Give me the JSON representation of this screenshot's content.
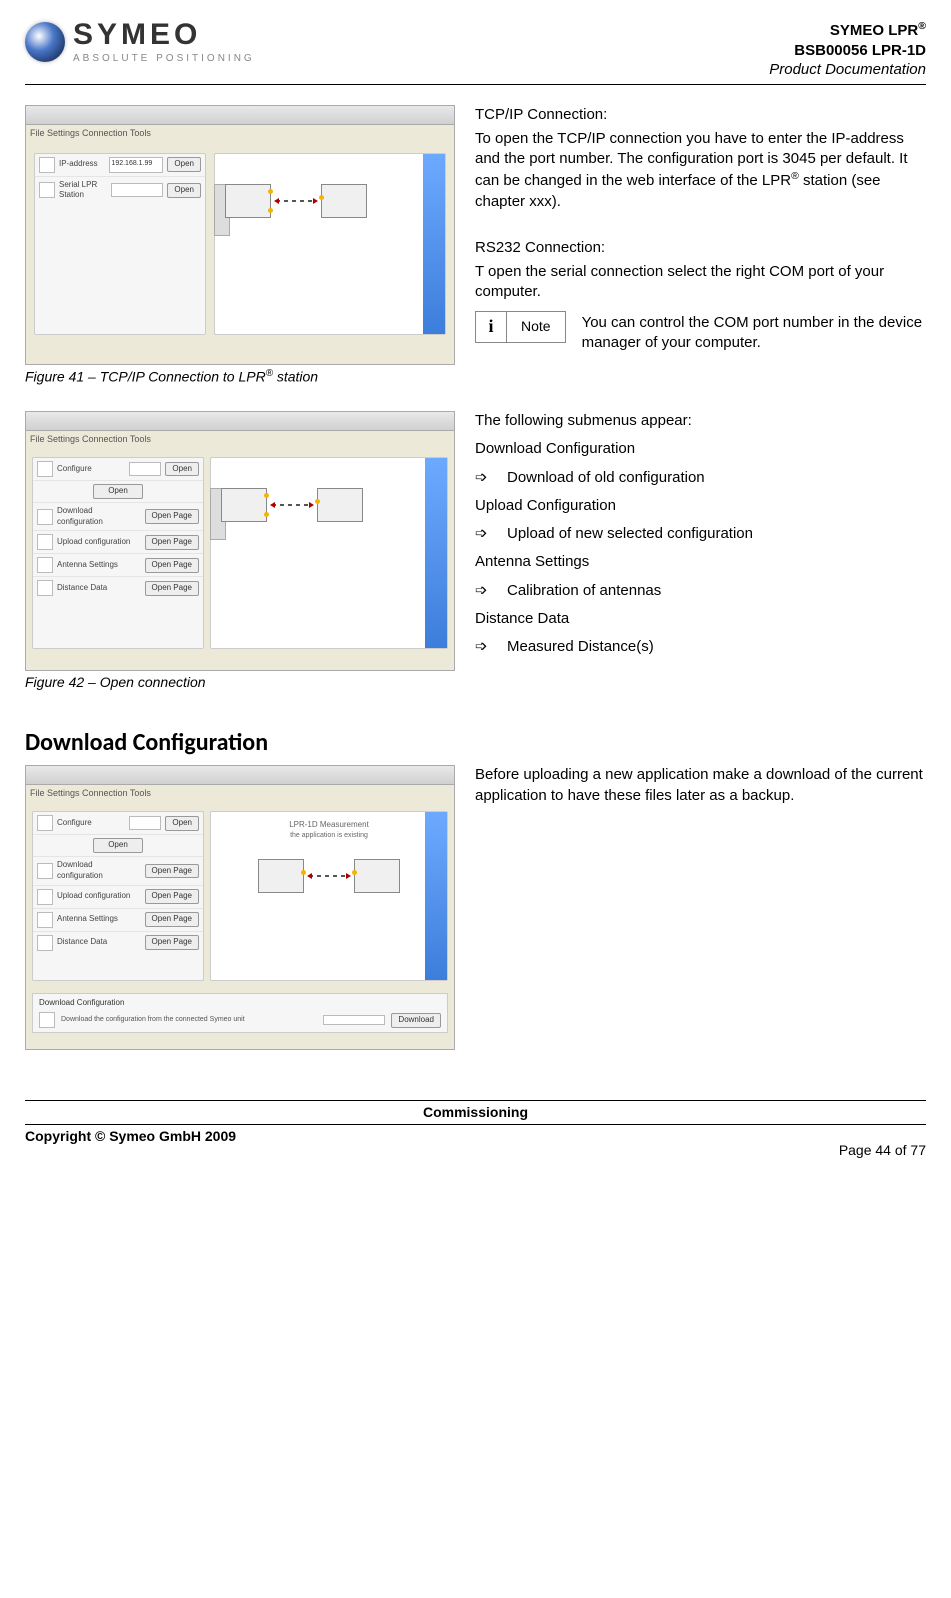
{
  "header": {
    "logo_name": "SYMEO",
    "logo_tag": "ABSOLUTE POSITIONING",
    "line1_pre": "SYMEO LPR",
    "line1_sup": "®",
    "line2": "BSB00056 LPR-1D",
    "line3": "Product Documentation"
  },
  "fig41": {
    "caption_pre": "Figure 41 – TCP/IP Connection to LPR",
    "caption_sup": "®",
    "caption_post": " station",
    "menu": "File   Settings   Connection   Tools",
    "row1_label": "IP-address",
    "row1_value": "192.168.1.99",
    "row1_btn": "Open",
    "row2_label": "Serial LPR Station",
    "row2_btn": "Open"
  },
  "tcp": {
    "title": "TCP/IP Connection:",
    "body_pre": "To open the TCP/IP connection you have to enter the IP-address and the port number. The configuration port is 3045 per default. It can be changed in the web interface of the LPR",
    "body_sup": "®",
    "body_post": " station (see chapter xxx)."
  },
  "rs232": {
    "title": "RS232 Connection:",
    "body": "T open the serial connection select the right COM port of your computer."
  },
  "note": {
    "label": "Note",
    "text": "You can control the COM port number in the device manager of your computer."
  },
  "fig42": {
    "caption": "Figure 42 – Open connection",
    "menu": "File   Settings   Connection   Tools",
    "row_conf": "Configure",
    "row_open": "Open",
    "list1": "Download configuration",
    "list2": "Upload configuration",
    "list3": "Antenna Settings",
    "list4": "Distance Data",
    "btn": "Open Page"
  },
  "submenu": {
    "intro": "The following submenus appear:",
    "h1": "Download Configuration",
    "d1": "Download of old configuration",
    "h2": "Upload Configuration",
    "d2": "Upload of new selected configuration",
    "h3": "Antenna Settings",
    "d3": "Calibration of antennas",
    "h4": "Distance Data",
    "d4": "Measured Distance(s)",
    "arrow": "➩"
  },
  "download": {
    "heading": "Download Configuration",
    "body": "Before uploading a new application make a download of the current application to have these files later as a backup.",
    "dl_label": "Download Configuration",
    "dl_sub": "Download the configuration from the connected Symeo unit",
    "dl_btn": "Download",
    "panel_title": "LPR-1D Measurement",
    "panel_sub": "the application is existing"
  },
  "footer": {
    "section": "Commissioning",
    "copyright": "Copyright © Symeo GmbH 2009",
    "page": "Page 44 of 77"
  }
}
